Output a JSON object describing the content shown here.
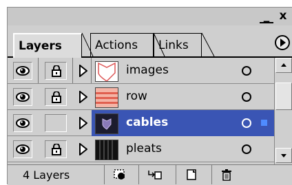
{
  "panel": {
    "tabs": [
      {
        "label": "Layers",
        "active": true
      },
      {
        "label": "Actions",
        "active": false
      },
      {
        "label": "Links",
        "active": false
      }
    ],
    "window_buttons": {
      "minimize": "_",
      "close": "x"
    }
  },
  "layers": [
    {
      "name": "images",
      "thumbnail": "shield-outline",
      "selected": false,
      "locked": true
    },
    {
      "name": "row",
      "thumbnail": "stripes-red",
      "selected": false,
      "locked": true
    },
    {
      "name": "cables",
      "thumbnail": "shield-dark",
      "selected": true,
      "locked": false
    },
    {
      "name": "pleats",
      "thumbnail": "pleats-dark",
      "selected": false,
      "locked": true
    }
  ],
  "footer": {
    "count_label": "4 Layers"
  },
  "colors": {
    "selection": "#3a55b4",
    "selection_marker": "#4f8cff"
  }
}
